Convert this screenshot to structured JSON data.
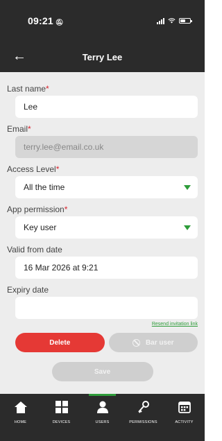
{
  "status_bar": {
    "time": "09:21"
  },
  "header": {
    "title": "Terry Lee"
  },
  "form": {
    "last_name": {
      "label": "Last name",
      "required_mark": "*",
      "value": "Lee"
    },
    "email": {
      "label": "Email",
      "required_mark": "*",
      "value": "terry.lee@email.co.uk"
    },
    "access_level": {
      "label": "Access Level",
      "required_mark": "*",
      "value": "All the time"
    },
    "app_permission": {
      "label": "App permission",
      "required_mark": "*",
      "value": "Key user"
    },
    "valid_from": {
      "label": "Valid from date",
      "value": "16 Mar 2026 at 9:21"
    },
    "expiry": {
      "label": "Expiry date",
      "value": ""
    },
    "resend_link": "Resend invitation link"
  },
  "actions": {
    "delete_label": "Delete",
    "bar_label": "Bar user",
    "save_label": "Save"
  },
  "tabs": [
    {
      "label": "HOME",
      "icon": "home-icon"
    },
    {
      "label": "DEVICES",
      "icon": "devices-icon"
    },
    {
      "label": "USERS",
      "icon": "users-icon"
    },
    {
      "label": "PERMISSIONS",
      "icon": "key-icon"
    },
    {
      "label": "ACTIVITY",
      "icon": "calendar-icon"
    }
  ],
  "colors": {
    "accent": "#2e9c3a",
    "danger": "#e53935",
    "header": "#2b2b2b",
    "background": "#ededed"
  }
}
